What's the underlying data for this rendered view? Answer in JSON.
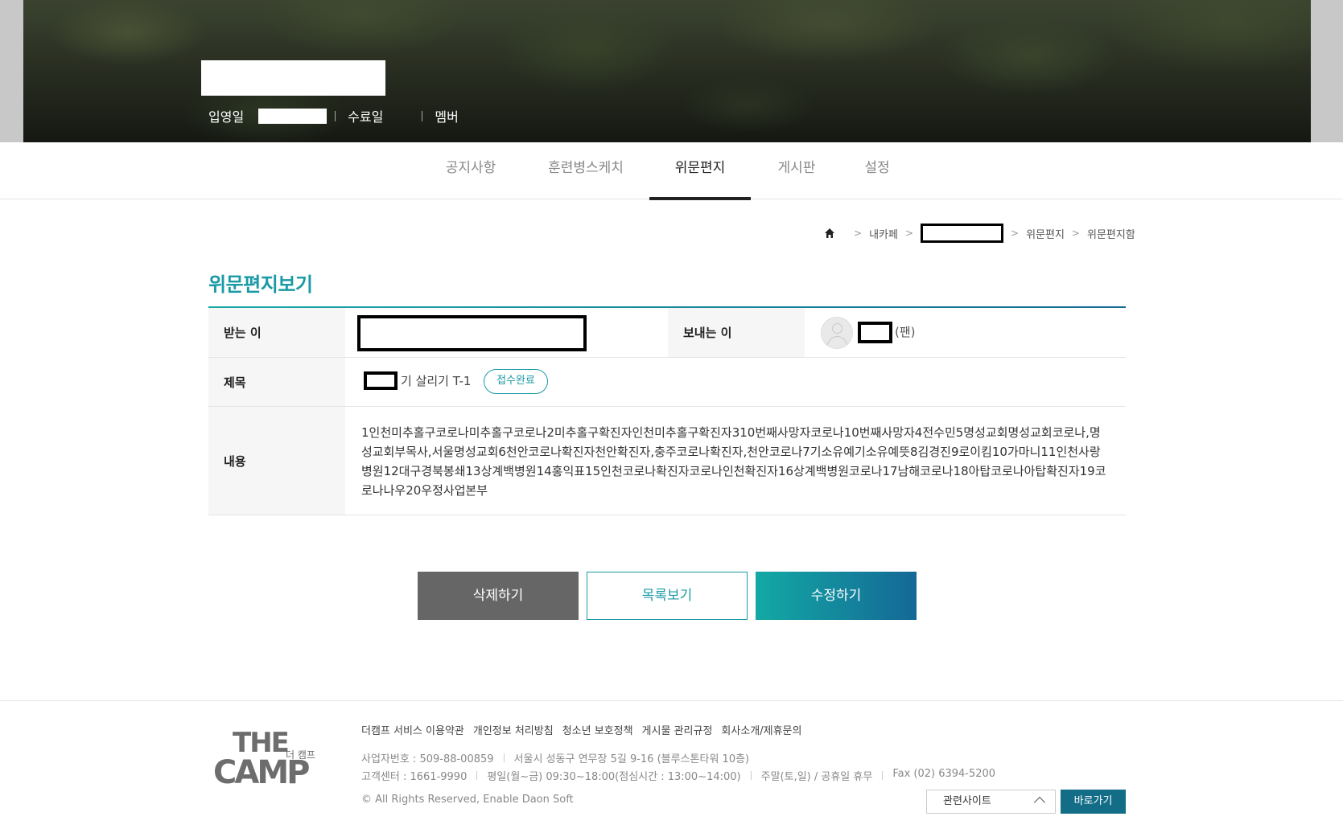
{
  "hero": {
    "enlist_label": "입영일",
    "complete_label": "수료일",
    "member_label": "멤버"
  },
  "tabs": [
    {
      "label": "공지사항"
    },
    {
      "label": "훈련병스케치"
    },
    {
      "label": "위문편지"
    },
    {
      "label": "게시판"
    },
    {
      "label": "설정"
    }
  ],
  "breadcrumb": {
    "home_icon": "home-icon",
    "items": [
      "내카페",
      "위문편지",
      "위문편지함"
    ]
  },
  "page": {
    "title": "위문편지보기"
  },
  "letter": {
    "receiver_label": "받는 이",
    "sender_label": "보내는 이",
    "sender_suffix": "(팬)",
    "subject_label": "제목",
    "subject_text": "기 살리기 T-1",
    "status_badge": "접수완료",
    "content_label": "내용",
    "content_text": "1인천미추홀구코로나미추홀구코로나2미추홀구확진자인천미추홀구확진자310번째사망자코로나10번째사망자4전수민5명성교회명성교회코로나,명성교회부목사,서울명성교회6천안코로나확진자천안확진자,충주코로나확진자,천안코로나7기소유예기소유예뜻8김경진9로이킴10가마니11인천사랑병원12대구경북봉쇄13상계백병원14홍익표15인천코로나확진자코로나인천확진자16상계백병원코로나17남해코로나18아탑코로나아탑확진자19코로나나우20우정사업본부"
  },
  "buttons": {
    "delete": "삭제하기",
    "list": "목록보기",
    "edit": "수정하기"
  },
  "footer": {
    "logo_the": "THE",
    "logo_kr": "더 캠프",
    "logo_camp": "CAMP",
    "links": [
      "더캠프 서비스 이용약관",
      "개인정보 처리방침",
      "청소년 보호정책",
      "게시물 관리규정",
      "회사소개/제휴문의"
    ],
    "biz_no": "사업자번호 : 509-88-00859",
    "address": "서울시 성동구 연무장 5길 9-16 (블루스톤타워 10층)",
    "cs_center": "고객센터 : 1661-9990",
    "weekday_hours": "평일(월~금) 09:30~18:00(점심시간 : 13:00~14:00)",
    "weekend": "주말(토,일) / 공휴일 휴무",
    "fax": "Fax (02) 6394-5200",
    "copyright": "© All Rights Reserved, Enable Daon Soft",
    "related_select": "관련사이트",
    "go_button": "바로가기"
  }
}
